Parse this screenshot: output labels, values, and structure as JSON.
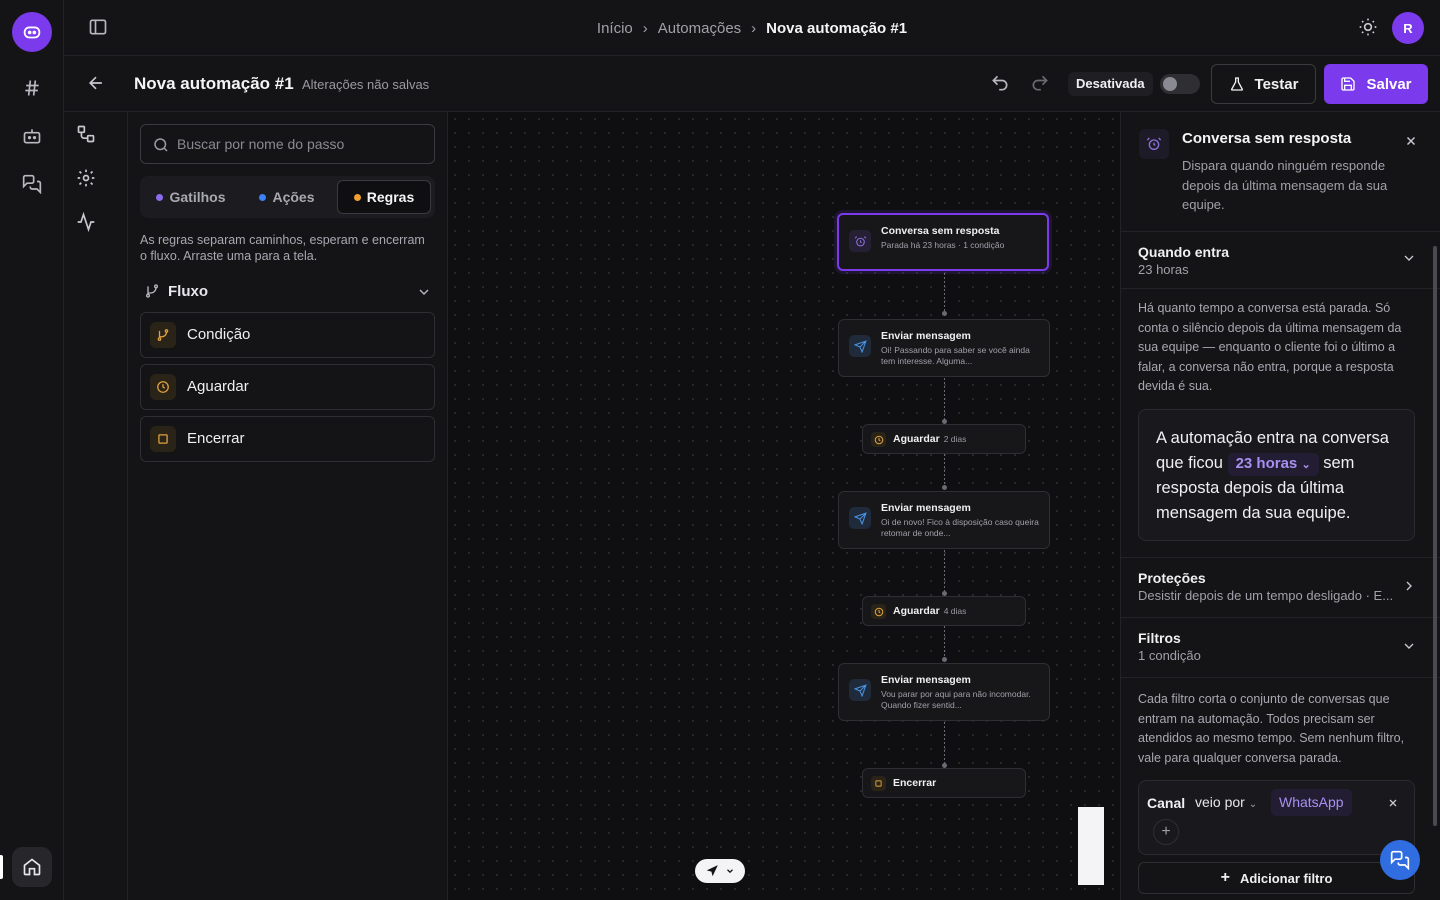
{
  "breadcrumb": {
    "items": [
      "Início",
      "Automações",
      "Nova automação #1"
    ],
    "separator": ">"
  },
  "user": {
    "avatar_initial": "R"
  },
  "header": {
    "title": "Nova automação #1",
    "unsaved_label": "Alterações não salvas",
    "status_label": "Desativada",
    "test_label": "Testar",
    "save_label": "Salvar",
    "toggle_on": false
  },
  "steps_panel": {
    "search_placeholder": "Buscar por nome do passo",
    "tabs": [
      {
        "label": "Gatilhos",
        "dot_color": "#8b6cf0",
        "active": false
      },
      {
        "label": "Ações",
        "dot_color": "#3b82f6",
        "active": false
      },
      {
        "label": "Regras",
        "dot_color": "#f0a030",
        "active": true
      }
    ],
    "hint": "As regras separam caminhos, esperam e encerram o fluxo. Arraste uma para a tela.",
    "group_label": "Fluxo",
    "rules": [
      {
        "label": "Condição",
        "icon": "branch-icon"
      },
      {
        "label": "Aguardar",
        "icon": "clock-icon"
      },
      {
        "label": "Encerrar",
        "icon": "stop-icon"
      }
    ]
  },
  "flow": {
    "trigger": {
      "title": "Conversa sem resposta",
      "desc": "Parada há 23 horas · 1 condição"
    },
    "msg1": {
      "title": "Enviar mensagem",
      "desc": "Oi! Passando para saber se você ainda tem interesse. Alguma..."
    },
    "wait1": {
      "title": "Aguardar",
      "desc": "2 dias"
    },
    "msg2": {
      "title": "Enviar mensagem",
      "desc": "Oi de novo! Fico à disposição caso queira retomar de onde..."
    },
    "wait2": {
      "title": "Aguardar",
      "desc": "4 dias"
    },
    "msg3": {
      "title": "Enviar mensagem",
      "desc": "Vou parar por aqui para não incomodar. Quando fizer sentid..."
    },
    "end": {
      "title": "Encerrar"
    }
  },
  "inspector": {
    "title": "Conversa sem resposta",
    "description": "Dispara quando ninguém responde depois da última mensagem da sua equipe.",
    "when": {
      "title": "Quando entra",
      "sub": "23 horas"
    },
    "when_body": "Há quanto tempo a conversa está parada. Só conta o silêncio depois da última mensagem da sua equipe — enquanto o cliente foi o último a falar, a conversa não entra, porque a resposta devida é sua.",
    "sentence": {
      "before": "A automação entra na conversa que ficou",
      "value": "23 horas",
      "after": "sem resposta depois da última mensagem da sua equipe."
    },
    "protections": {
      "title": "Proteções",
      "sub": "Desistir depois de um tempo desligado · E..."
    },
    "filters": {
      "title": "Filtros",
      "sub": "1 condição"
    },
    "filters_body": "Cada filtro corta o conjunto de conversas que entram na automação. Todos precisam ser atendidos ao mesmo tempo. Sem nenhum filtro, vale para qualquer conversa parada.",
    "filter": {
      "field": "Canal",
      "operator": "veio por",
      "value": "WhatsApp"
    },
    "add_filter_label": "Adicionar filtro"
  }
}
